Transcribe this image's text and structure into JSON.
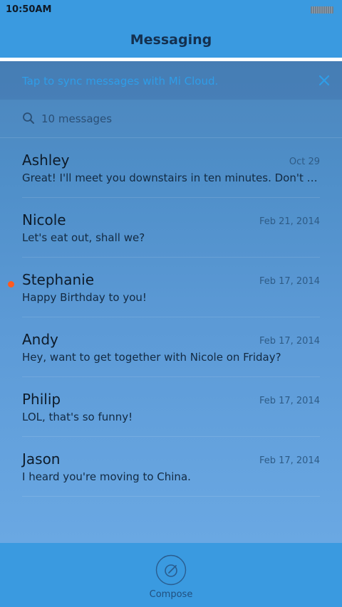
{
  "status_bar": {
    "time": "10:50AM",
    "battery_icon": "battery-icon"
  },
  "header": {
    "title": "Messaging"
  },
  "sync_banner": {
    "text": "Tap to sync messages with Mi Cloud.",
    "close_icon": "close-icon"
  },
  "search": {
    "icon": "search-icon",
    "text": "10 messages"
  },
  "conversations": [
    {
      "name": "Ashley",
      "date": "Oct 29",
      "preview": "Great! I'll meet you downstairs in ten minutes. Don't forget",
      "unread": false
    },
    {
      "name": "Nicole",
      "date": "Feb 21, 2014",
      "preview": "Let's eat out, shall we?",
      "unread": false
    },
    {
      "name": "Stephanie",
      "date": "Feb 17, 2014",
      "preview": "Happy Birthday to you!",
      "unread": true
    },
    {
      "name": "Andy",
      "date": "Feb 17, 2014",
      "preview": "Hey, want to get together with Nicole on Friday?",
      "unread": false
    },
    {
      "name": "Philip",
      "date": "Feb 17, 2014",
      "preview": "LOL, that's so funny!",
      "unread": false
    },
    {
      "name": "Jason",
      "date": "Feb 17, 2014",
      "preview": "I heard you're moving to China.",
      "unread": false
    }
  ],
  "bottom_bar": {
    "compose_label": "Compose",
    "compose_icon": "compose-icon"
  },
  "colors": {
    "accent": "#3a9ae0",
    "unread_dot": "#ff5a1f",
    "sync_text": "#2f9de8"
  }
}
